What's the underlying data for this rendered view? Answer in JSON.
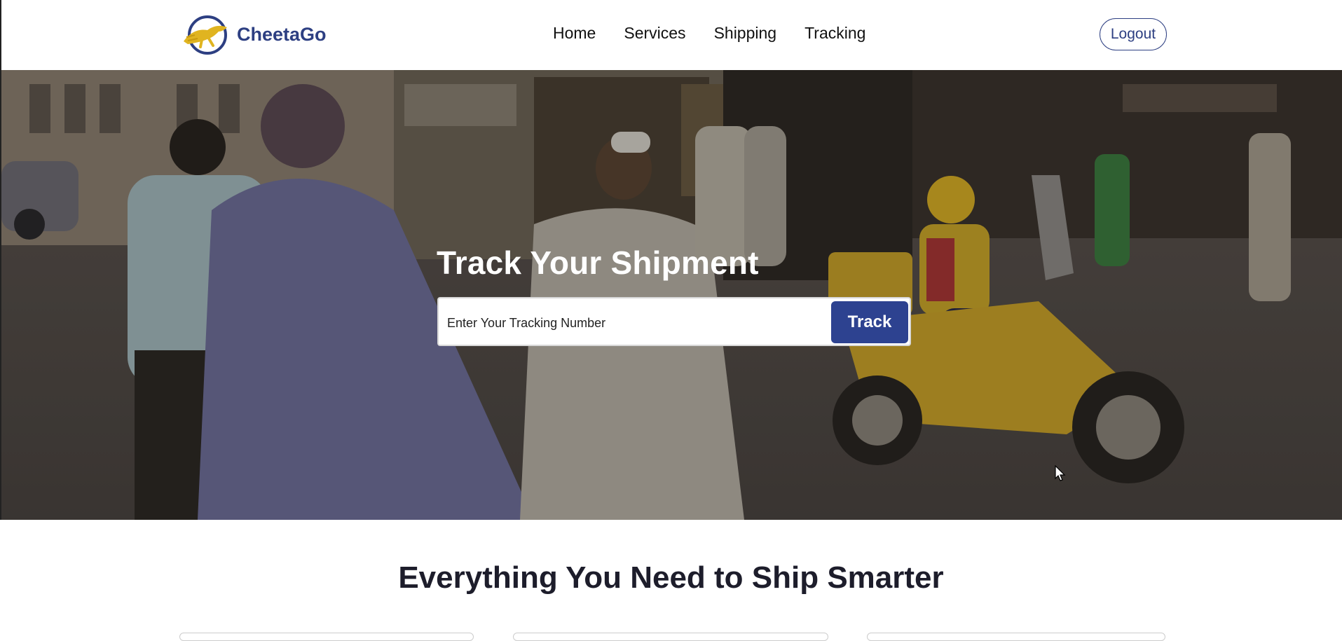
{
  "brand": {
    "name": "CheetaGo"
  },
  "nav": {
    "items": [
      "Home",
      "Services",
      "Shipping",
      "Tracking"
    ]
  },
  "header": {
    "logout_label": "Logout"
  },
  "hero": {
    "title": "Track Your Shipment",
    "input_placeholder": "Enter Your Tracking Number",
    "input_value": "",
    "track_label": "Track"
  },
  "features": {
    "heading": "Everything You Need to Ship Smarter"
  },
  "colors": {
    "brand": "#2d3f82",
    "accent": "#2d4290",
    "logo_gold": "#e0b420"
  },
  "icons": {
    "logo": "cheetah-logo-icon",
    "cursor": "mouse-pointer-icon"
  }
}
